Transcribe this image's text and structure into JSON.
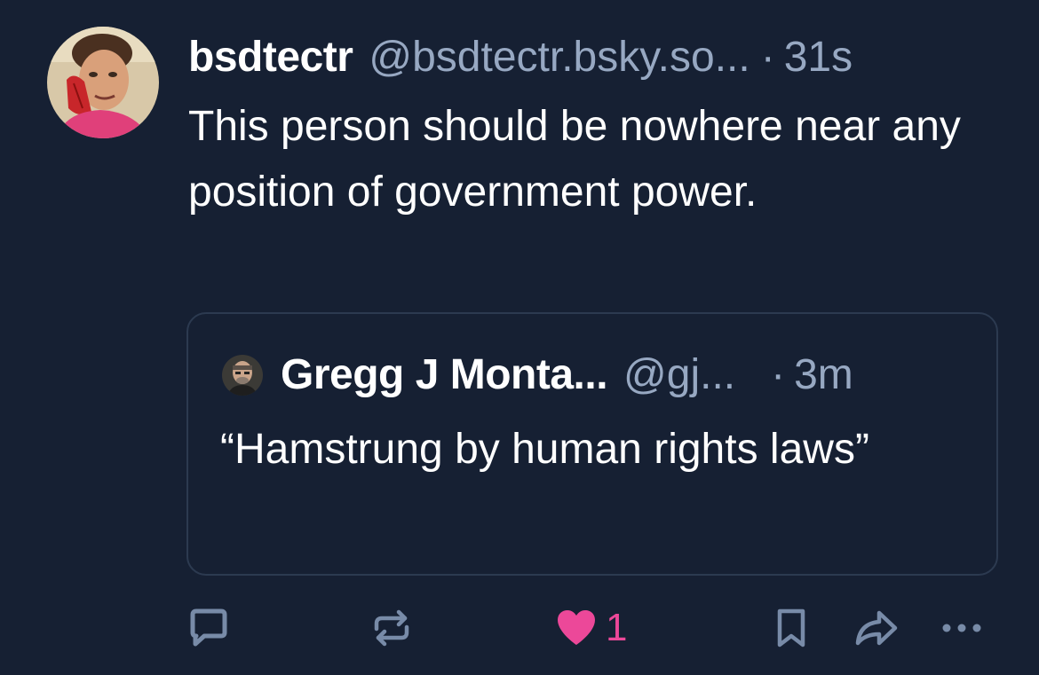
{
  "post": {
    "author": {
      "display_name": "bsdtectr",
      "handle": "@bsdtectr.bsky.so...",
      "avatar_icon": "avatar-photo"
    },
    "separator": "·",
    "timestamp": "31s",
    "text": "This person should be nowhere near any position of government power."
  },
  "quote": {
    "author": {
      "display_name": "Gregg J Monta...",
      "handle": "@gj...",
      "avatar_icon": "avatar-photo"
    },
    "separator": "·",
    "timestamp": "3m",
    "text": "“Hamstrung by human rights laws”"
  },
  "actions": {
    "reply_icon": "reply-icon",
    "repost_icon": "repost-icon",
    "like_icon": "heart-icon",
    "like_count": "1",
    "bookmark_icon": "bookmark-icon",
    "share_icon": "share-icon",
    "more_icon": "more-icon"
  },
  "colors": {
    "background": "#162033",
    "secondary_text": "#97a8c2",
    "like_pink": "#ec4899",
    "icon_blue": "#788ba8",
    "card_border": "#2c3a50"
  }
}
